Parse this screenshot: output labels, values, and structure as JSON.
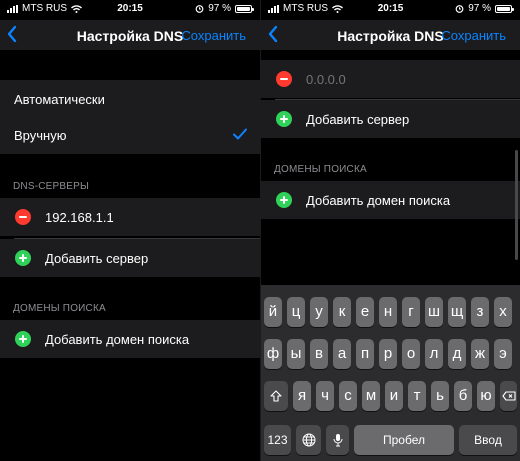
{
  "status": {
    "carrier": "MTS RUS",
    "time": "20:15",
    "battery": "97 %",
    "battery_level": 0.97
  },
  "nav": {
    "title": "Настройка DNS",
    "save": "Сохранить"
  },
  "left": {
    "mode_options": [
      {
        "label": "Автоматически",
        "selected": false
      },
      {
        "label": "Вручную",
        "selected": true
      }
    ],
    "dns_header": "DNS-СЕРВЕРЫ",
    "servers": [
      "192.168.1.1"
    ],
    "add_server": "Добавить сервер",
    "domains_header": "ДОМЕНЫ ПОИСКА",
    "add_domain": "Добавить домен поиска"
  },
  "right": {
    "new_server_placeholder": "0.0.0.0",
    "add_server": "Добавить сервер",
    "domains_header": "ДОМЕНЫ ПОИСКА",
    "add_domain": "Добавить домен поиска"
  },
  "keyboard": {
    "row1": [
      "й",
      "ц",
      "у",
      "к",
      "е",
      "н",
      "г",
      "ш",
      "щ",
      "з",
      "х"
    ],
    "row2": [
      "ф",
      "ы",
      "в",
      "а",
      "п",
      "р",
      "о",
      "л",
      "д",
      "ж",
      "э"
    ],
    "row3": [
      "я",
      "ч",
      "с",
      "м",
      "и",
      "т",
      "ь",
      "б",
      "ю"
    ],
    "numbers": "123",
    "space": "Пробел",
    "return": "Ввод"
  },
  "colors": {
    "accent": "#0a84ff",
    "delete": "#ff3b30",
    "add": "#30d158",
    "cell": "#1c1c1e"
  }
}
